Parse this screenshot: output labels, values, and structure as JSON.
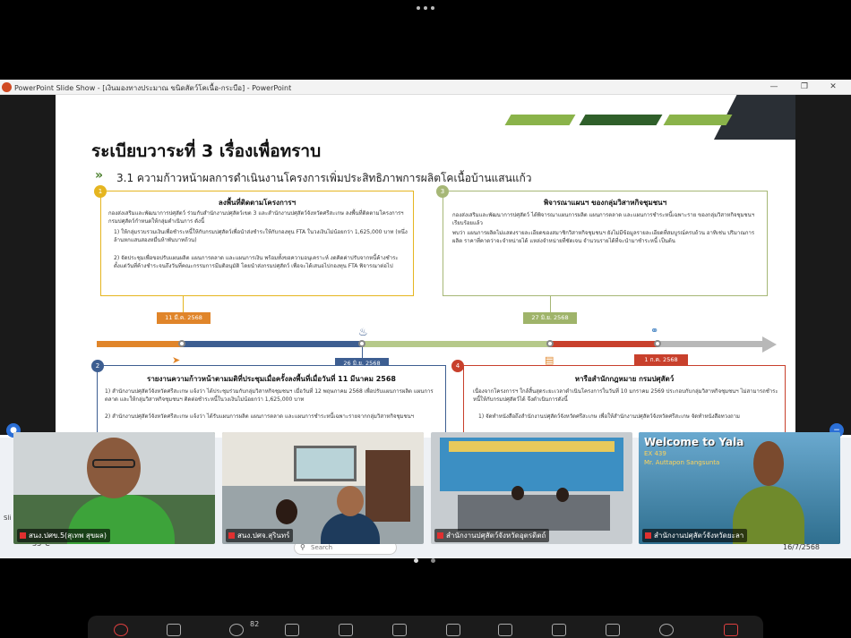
{
  "window": {
    "title": "PowerPoint Slide Show - [เงินมองทางประมาณ  ขนิดสัตว์โคเนื้อ-กระบือ] - PowerPoint"
  },
  "slide": {
    "title": "ระเบียบวาระที่ 3  เรื่องเพื่อทราบ",
    "subtitle": "3.1 ความก้าวหน้าผลการดำเนินงานโครงการเพิ่มประสิทธิภาพการผลิตโคเนื้อบ้านแสนแก้ว",
    "box1": {
      "num": "1",
      "title": "ลงพื้นที่ติดตามโครงการฯ",
      "text": "กองส่งเสริมและพัฒนาการปศุสัตว์ ร่วมกับสำนักงานปศุสัตว์เขต 3 และสำนักงานปศุสัตว์จังหวัดศรีสะเกษ ลงพื้นที่ติดตามโครงการฯ กรมปศุสัตว์กำหนดให้กลุ่มดำเนินการ ดังนี้",
      "item1": "1) ให้กลุ่มรวบรวมเงินเพื่อชำระหนี้ให้กับกรมปศุสัตว์เพื่อนำส่งชำระให้กับกองทุน FTA  ในวงเงินไม่น้อยกว่า 1,625,000 บาท (หนึ่งล้านหกแสนสองหมื่นห้าพันบาทถ้วน)",
      "item2": "2) จัดประชุมเพื่อขอปรับแผนผลิต แผนการตลาด และแผนการเงิน พร้อมทั้งขอความอนุเคราะห์ งดคิดค่าปรับจากหนี้ค้างชำระตั้งแต่วันที่ค้างชำระจนถึงวันที่คณะกรรมการมีมติอนุมัติ โดยนำส่งกรมปศุสัตว์ เพื่อจะได้เสนอไปกองทุน FTA พิจารณาต่อไป"
    },
    "box3": {
      "num": "3",
      "title": "พิจารณาแผนฯ ของกลุ่มวิสาหกิจชุมชนฯ",
      "text1": "กองส่งเสริมและพัฒนาการปศุสัตว์ ได้พิจารณาแผนการผลิต แผนการตลาด และแผนการชำระหนี้เฉพาะราย ของกลุ่มวิสาหกิจชุมชนฯ เรียบร้อยแล้ว",
      "text2": "พบว่า แผนการผลิตไม่แสดงรายละเอียดของสมาชิกวิสาหกิจชุมชนฯ ยังไม่มีข้อมูลรายละเอียดที่สมบูรณ์ครบถ้วน อาทิเช่น ปริมาณการผลิต ราคาที่คาดว่าจะจำหน่ายได้ แหล่งจำหน่ายที่ชัดเจน จำนวนรายได้ที่จะนำมาชำระหนี้ เป็นต้น"
    },
    "box2": {
      "num": "2",
      "title": "รายงานความก้าวหน้าตามมติที่ประชุมเมื่อครั้งลงพื้นที่เมื่อวันที่ 11 มีนาคม 2568",
      "text1": "1) สำนักงานปศุสัตว์จังหวัดศรีสะเกษ แจ้งว่า ได้ประชุมร่วมกับกลุ่มวิสาหกิจชุมชนฯ เมื่อวันที่ 12 พฤษภาคม 2568 เพื่อปรับแผนการผลิต แผนการตลาด และให้กลุ่มวิสาหกิจชุมชนฯ ติดต่อชำระหนี้ในวงเงินไม่น้อยกว่า 1,625,000 บาท",
      "text2": "2) สำนักงานปศุสัตว์จังหวัดศรีสะเกษ แจ้งว่า ได้รับแผนการผลิต แผนการตลาด และแผนการชำระหนี้เฉพาะรายจากกลุ่มวิสาหกิจชุมชนฯ"
    },
    "box4": {
      "num": "4",
      "title": "หารือสำนักกฎหมาย กรมปศุสัตว์",
      "text1": "เนื่องจากโครงการฯ ใกล้สิ้นสุดระยะเวลาดำเนินโครงการในวันที่ 10 มกราคม 2569 ประกอบกับกลุ่มวิสาหกิจชุมชนฯ ไม่สามารถชำระหนี้ให้กับกรมปศุสัตว์ได้ จึงดำเนินการดังนี้",
      "text2": "1) จัดทำหนังสือถึงสำนักงานปศุสัตว์จังหวัดศรีสะเกษ เพื่อให้สำนักงานปศุสัตว์จังหวัดศรีสะเกษ จัดทำหนังสือทวงถาม"
    },
    "dates": {
      "d1": "11 มี.ค. 2568",
      "d2": "26 มิ.ย. 2568",
      "d3": "27 มิ.ย. 2568",
      "d4": "1 ก.ค. 2568"
    }
  },
  "taskbar": {
    "temp": "33°C",
    "search": "Search",
    "date": "16/7/2568",
    "left_stub": "Sli"
  },
  "tiles": [
    {
      "label": "สนง.ปศข.5(สุเทพ สุขผล)"
    },
    {
      "label": "สนง.ปศจ.สุรินทร์"
    },
    {
      "label": "สำนักงานปศุสัตว์จังหวัดอุตรดิตถ์"
    },
    {
      "label": "สำนักงานปศุสัตว์จังหวัดยะลา",
      "banner": "Welcome to Yala",
      "sub1": "EX 439",
      "sub2": "Mr. Auttapon Sangsunta"
    }
  ],
  "toolbar": {
    "participants": "82"
  },
  "colors": {
    "green": "#6a9a2c",
    "dark_green": "#2f5f2a",
    "orange": "#e0852a",
    "blue": "#3d5e91",
    "olive": "#b6c98a",
    "red": "#c8402c",
    "gray": "#b8b8b8"
  }
}
